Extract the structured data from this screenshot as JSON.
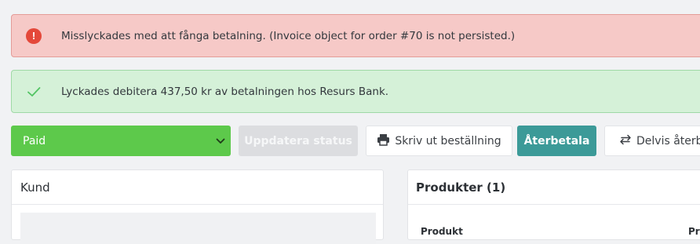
{
  "alerts": {
    "error": {
      "icon": "error-icon",
      "color": "#e4483a",
      "message": "Misslyckades med att fånga betalning. (Invoice object for order #70 is not persisted.)"
    },
    "success": {
      "icon": "checkmark-icon",
      "color": "#52c463",
      "message": "Lyckades debitera 437,50 kr av betalningen hos Resurs Bank."
    }
  },
  "toolbar": {
    "status_select": {
      "value": "Paid",
      "color": "#5dc94b"
    },
    "update_status_label": "Uppdatera status",
    "print_label": "Skriv ut beställning",
    "refund_label": "Återbetala",
    "partial_refund_label": "Delvis återb"
  },
  "panels": {
    "customer": {
      "title": "Kund"
    },
    "products": {
      "title": "Produkter (1)",
      "columns": [
        "Produkt",
        "Pr"
      ]
    }
  }
}
